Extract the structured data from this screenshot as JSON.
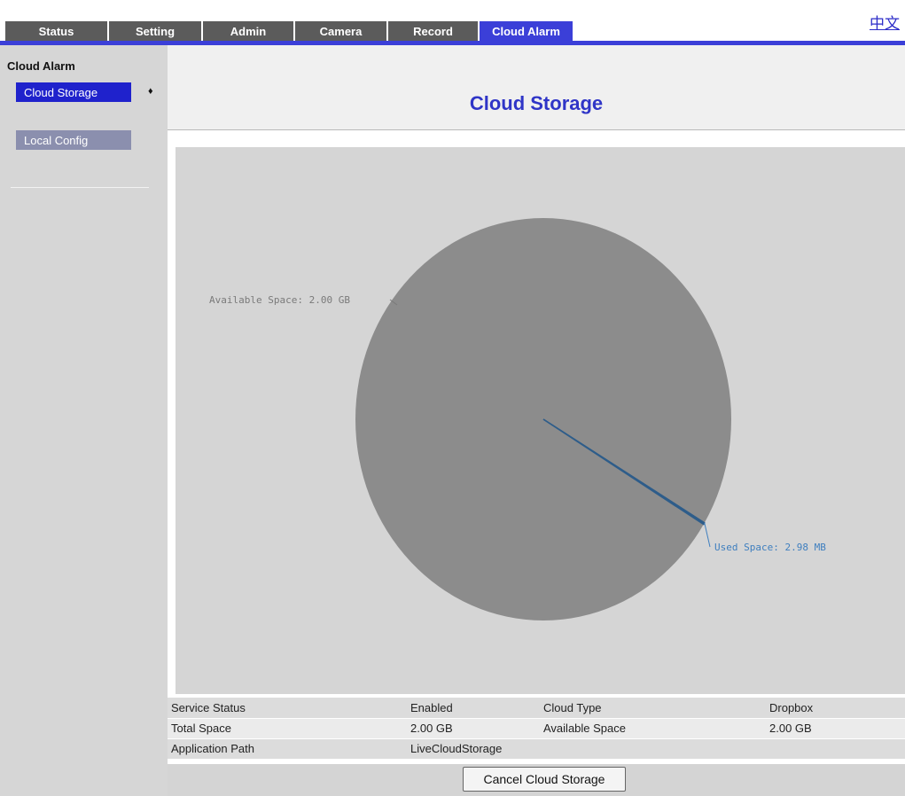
{
  "tabs": [
    {
      "label": "Status",
      "active": false
    },
    {
      "label": "Setting",
      "active": false
    },
    {
      "label": "Admin",
      "active": false
    },
    {
      "label": "Camera",
      "active": false
    },
    {
      "label": "Record",
      "active": false
    },
    {
      "label": "Cloud Alarm",
      "active": true
    }
  ],
  "language_link": "中文",
  "sidebar": {
    "title": "Cloud Alarm",
    "items": [
      {
        "label": "Cloud Storage",
        "selected": true
      },
      {
        "label": "Local Config",
        "selected": false
      }
    ],
    "selected_marker": "♦"
  },
  "page": {
    "title": "Cloud Storage"
  },
  "chart_data": {
    "type": "pie",
    "slices": [
      {
        "label": "Available Space",
        "value": 2048,
        "display": "Available Space: 2.00 GB"
      },
      {
        "label": "Used Space",
        "value": 2.98,
        "display": "Used Space: 2.98 MB"
      }
    ],
    "unit": "MB",
    "colors": {
      "available": "#8c8c8c",
      "used": "#2e5d8a",
      "available_label": "#7a7a7a",
      "used_label": "#3f7fbf"
    }
  },
  "info": {
    "rows": [
      [
        "Service Status",
        "Enabled",
        "Cloud Type",
        "Dropbox"
      ],
      [
        "Total Space",
        "2.00 GB",
        "Available Space",
        "2.00 GB"
      ],
      [
        "Application Path",
        "LiveCloudStorage",
        "",
        ""
      ]
    ]
  },
  "actions": {
    "cancel_label": "Cancel Cloud Storage"
  },
  "colors": {
    "tab_bg": "#5b5b5b",
    "tab_active": "#3b3fd8",
    "accent": "#2f35c7",
    "nav_selected": "#1f22cc",
    "nav_item": "#8b8fae"
  }
}
